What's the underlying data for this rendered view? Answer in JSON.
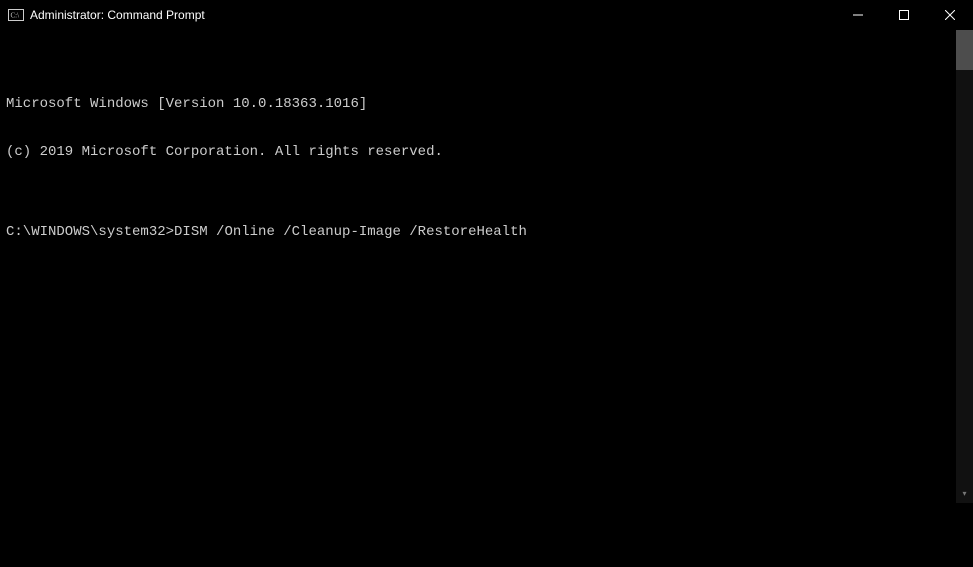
{
  "titlebar": {
    "title": "Administrator: Command Prompt"
  },
  "terminal": {
    "line1": "Microsoft Windows [Version 10.0.18363.1016]",
    "line2": "(c) 2019 Microsoft Corporation. All rights reserved.",
    "blank": "",
    "prompt": "C:\\WINDOWS\\system32>",
    "command": "DISM /Online /Cleanup-Image /RestoreHealth"
  }
}
